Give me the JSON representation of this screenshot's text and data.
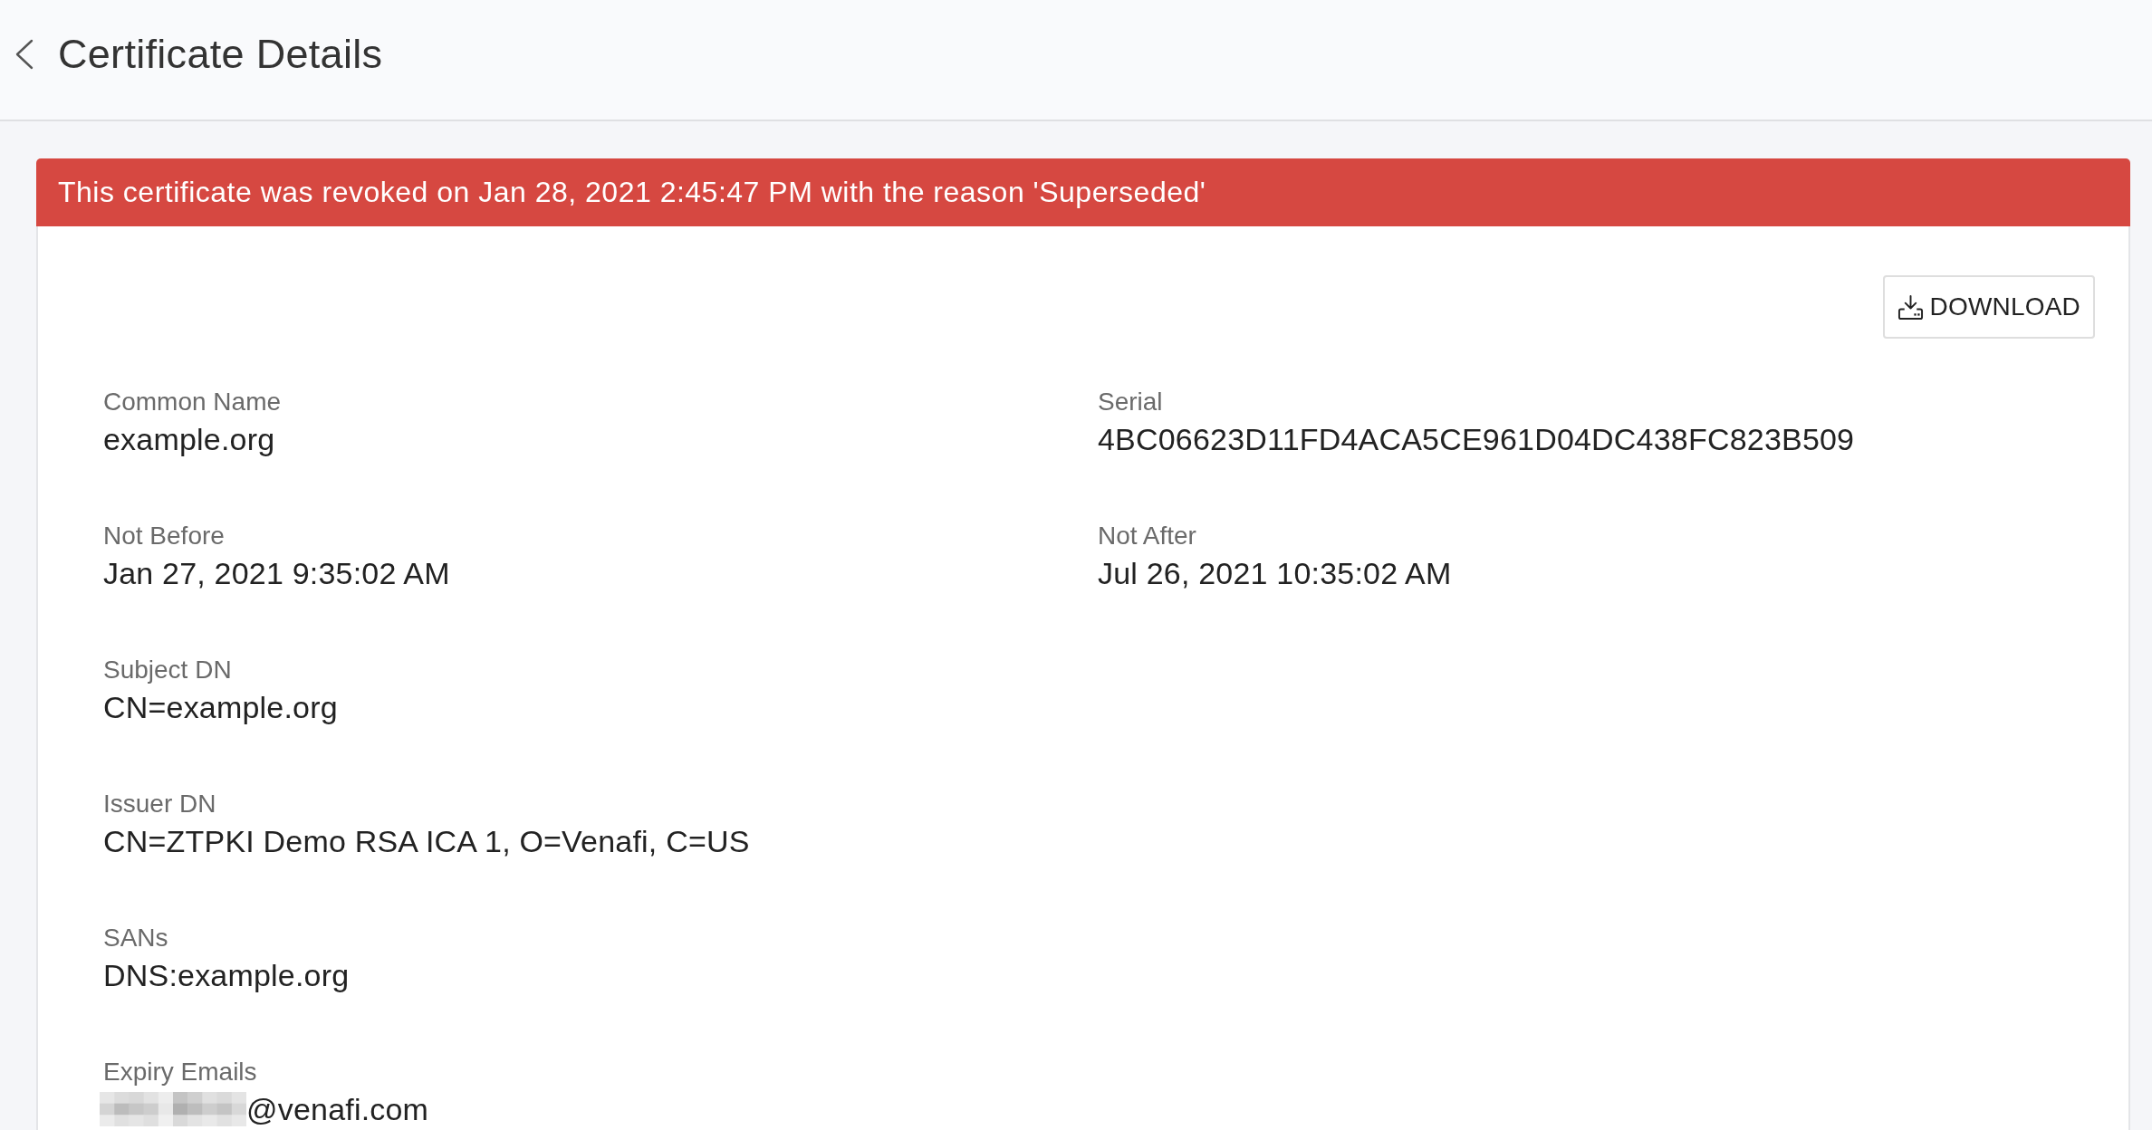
{
  "header": {
    "title": "Certificate Details"
  },
  "alert": {
    "kind": "error",
    "message": "This certificate was revoked on Jan 28, 2021 2:45:47 PM with the reason 'Superseded'"
  },
  "download_button": {
    "label": "DOWNLOAD"
  },
  "rows": [
    [
      {
        "label": "Common Name",
        "value": "example.org"
      },
      {
        "label": "Serial",
        "value": "4BC06623D11FD4ACA5CE961D04DC438FC823B509"
      }
    ],
    [
      {
        "label": "Not Before",
        "value": "Jan 27, 2021 9:35:02 AM"
      },
      {
        "label": "Not After",
        "value": "Jul 26, 2021 10:35:02 AM"
      }
    ],
    [
      {
        "label": "Subject DN",
        "value": "CN=example.org"
      }
    ],
    [
      {
        "label": "Issuer DN",
        "value": "CN=ZTPKI Demo RSA ICA 1, O=Venafi, C=US"
      }
    ],
    [
      {
        "label": "SANs",
        "value": "DNS:example.org"
      }
    ],
    [
      {
        "label": "Expiry Emails",
        "value": "@venafi.com",
        "redacted": true
      }
    ]
  ]
}
